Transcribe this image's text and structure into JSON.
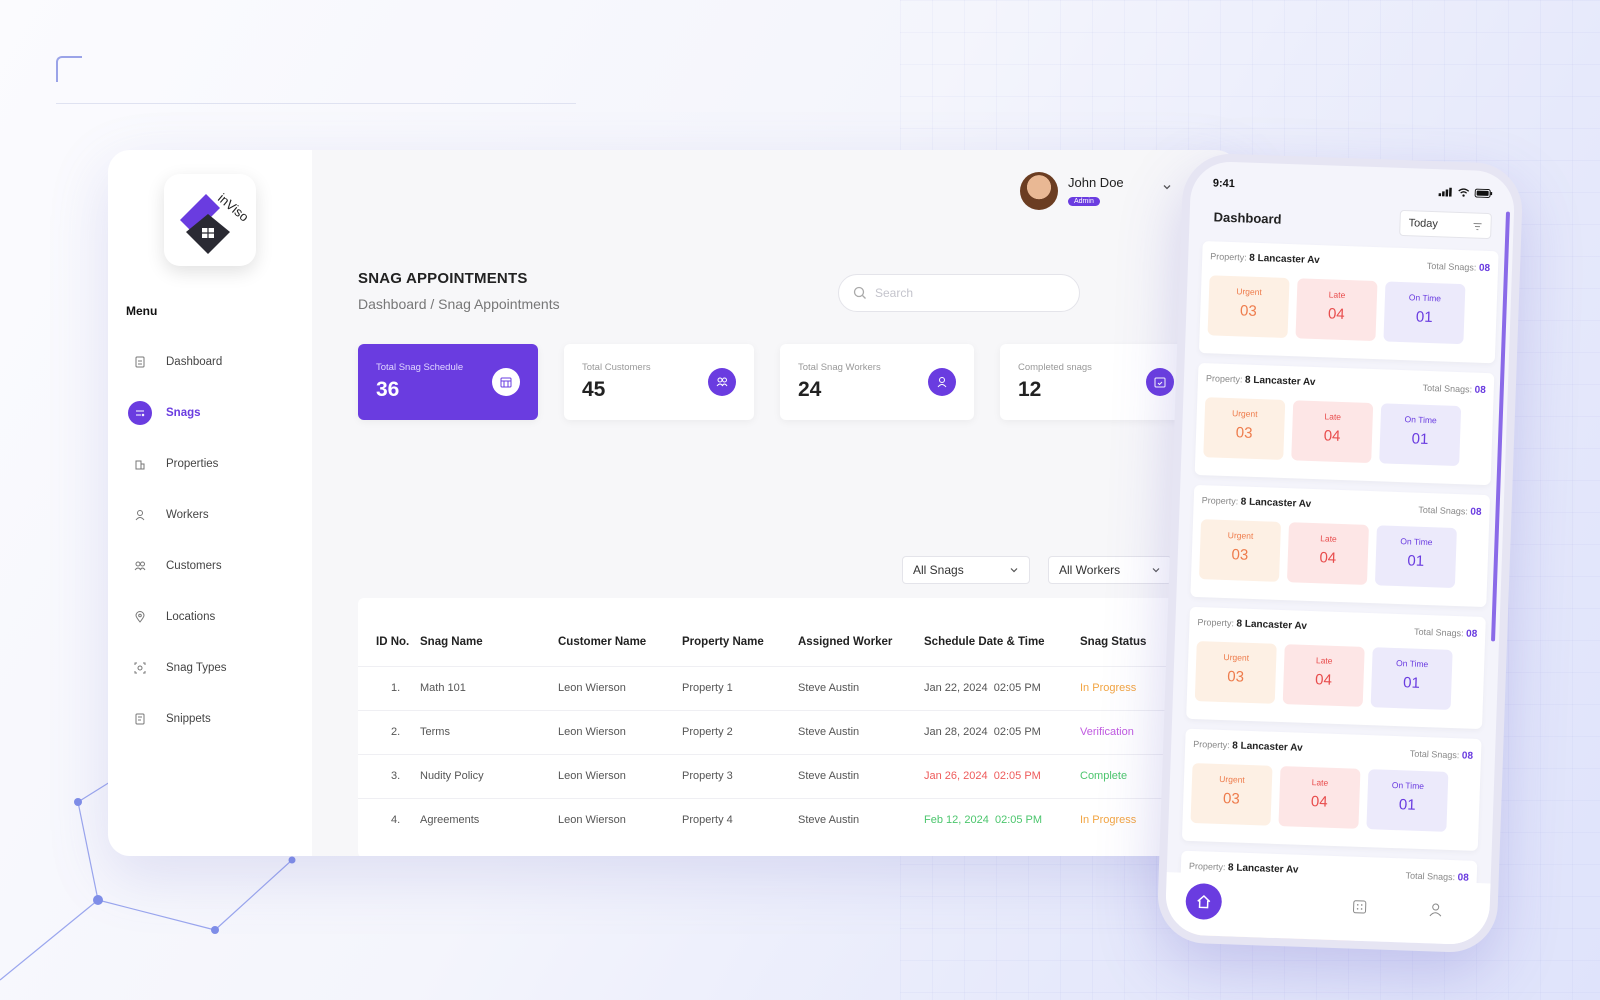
{
  "app": {
    "logo_text": "inViso"
  },
  "sidebar": {
    "menu_title": "Menu",
    "items": [
      {
        "label": "Dashboard",
        "icon": "document-icon"
      },
      {
        "label": "Snags",
        "icon": "snag-icon",
        "active": true
      },
      {
        "label": "Properties",
        "icon": "building-icon"
      },
      {
        "label": "Workers",
        "icon": "worker-icon"
      },
      {
        "label": "Customers",
        "icon": "customers-icon"
      },
      {
        "label": "Locations",
        "icon": "location-icon"
      },
      {
        "label": "Snag Types",
        "icon": "snag-types-icon"
      },
      {
        "label": "Snippets",
        "icon": "snippets-icon"
      }
    ]
  },
  "user": {
    "name": "John Doe",
    "role": "Admin"
  },
  "header": {
    "title": "SNAG APPOINTMENTS",
    "breadcrumb": "Dashboard / Snag Appointments",
    "search_placeholder": "Search"
  },
  "stats": [
    {
      "label": "Total Snag Schedule",
      "value": "36",
      "icon": "calendar-grid-icon"
    },
    {
      "label": "Total Customers",
      "value": "45",
      "icon": "customers-icon"
    },
    {
      "label": "Total Snag Workers",
      "value": "24",
      "icon": "worker-icon"
    },
    {
      "label": "Completed snags",
      "value": "12",
      "icon": "calendar-check-icon"
    }
  ],
  "filters": {
    "snags": "All Snags",
    "workers": "All Workers"
  },
  "table": {
    "columns": [
      "ID No.",
      "Snag Name",
      "Customer Name",
      "Property Name",
      "Assigned Worker",
      "Schedule Date & Time",
      "Snag Status"
    ],
    "rows": [
      {
        "id": "1.",
        "snag": "Math 101",
        "customer": "Leon Wierson",
        "property": "Property 1",
        "worker": "Steve Austin",
        "date": "Jan 22, 2024",
        "time": "02:05 PM",
        "status": "In Progress"
      },
      {
        "id": "2.",
        "snag": "Terms",
        "customer": "Leon Wierson",
        "property": "Property 2",
        "worker": "Steve Austin",
        "date": "Jan 28, 2024",
        "time": "02:05 PM",
        "status": "Verification"
      },
      {
        "id": "3.",
        "snag": "Nudity Policy",
        "customer": "Leon Wierson",
        "property": "Property 3",
        "worker": "Steve Austin",
        "date": "Jan 26, 2024",
        "time": "02:05 PM",
        "status": "Complete"
      },
      {
        "id": "4.",
        "snag": "Agreements",
        "customer": "Leon Wierson",
        "property": "Property 4",
        "worker": "Steve Austin",
        "date": "Feb 12, 2024",
        "time": "02:05 PM",
        "status": "In Progress"
      }
    ]
  },
  "phone": {
    "time": "9:41",
    "title": "Dashboard",
    "dropdown": "Today",
    "card": {
      "property_label": "Property:",
      "property": "8 Lancaster Av",
      "total_label": "Total Snags:",
      "total": "08",
      "urgent_label": "Urgent",
      "urgent": "03",
      "late_label": "Late",
      "late": "04",
      "ontime_label": "On Time",
      "ontime": "01"
    }
  },
  "colors": {
    "accent": "#6a3ce0",
    "urgent": "#ee7c4c",
    "late": "#e84d4d",
    "complete": "#4cc66d",
    "verification": "#c05ae0",
    "in_progress": "#f2a543"
  }
}
